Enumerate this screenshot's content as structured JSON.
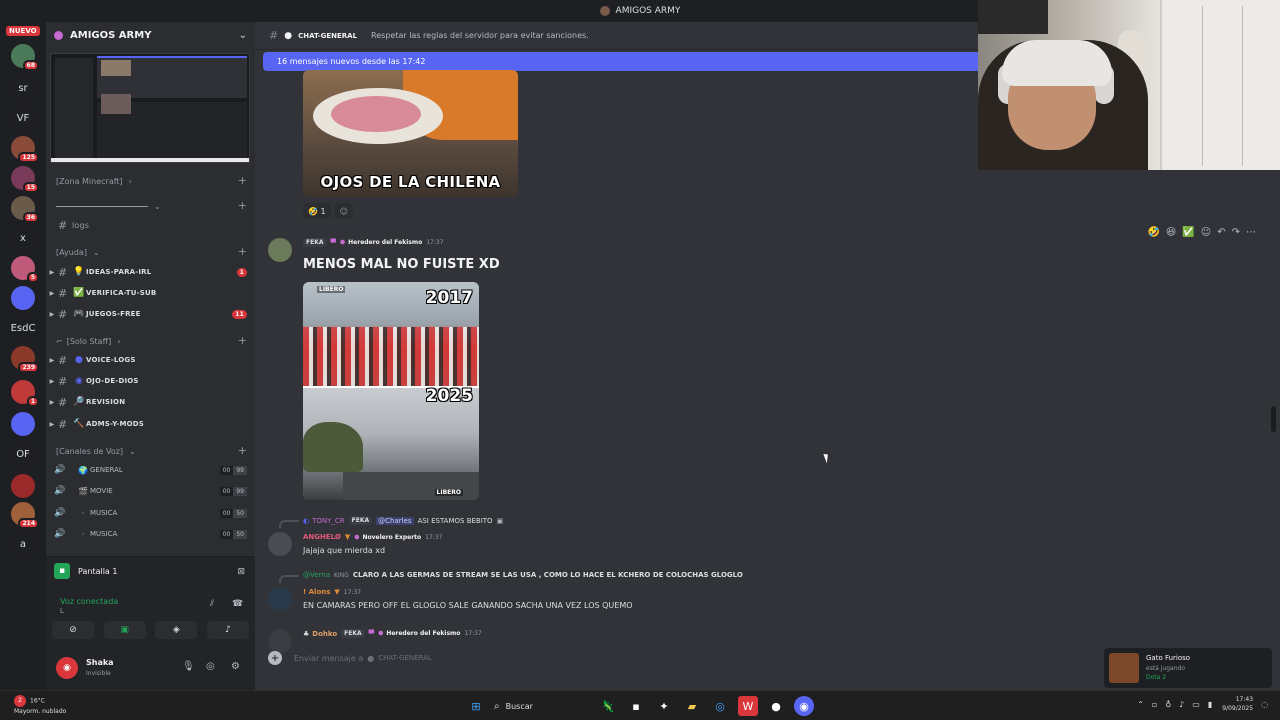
{
  "window": {
    "title": "AMIGOS ARMY"
  },
  "rail": {
    "new_label": "NUEVO",
    "servers": [
      {
        "label": "",
        "count": "68",
        "color": "#4a7a5a"
      },
      {
        "label": "sr",
        "count": "",
        "color": "#1e1f22"
      },
      {
        "label": "VF",
        "count": "",
        "color": "#1e1f22"
      },
      {
        "label": "",
        "count": "125",
        "color": "#8a4a3a"
      },
      {
        "label": "",
        "count": "15",
        "color": "#7a3a5a"
      },
      {
        "label": "",
        "count": "36",
        "color": "#6a5a4a"
      },
      {
        "label": "x",
        "count": "",
        "color": "#1e1f22"
      },
      {
        "label": "",
        "count": "5",
        "color": "#c05a7a"
      },
      {
        "label": "",
        "count": "",
        "color": "#5865f2"
      },
      {
        "label": "EsdC",
        "count": "",
        "color": "#1e1f22"
      },
      {
        "label": "",
        "count": "239",
        "color": "#8a3a2a"
      },
      {
        "label": "",
        "count": "1",
        "color": "#c03a3a"
      },
      {
        "label": "",
        "count": "",
        "color": "#5865f2"
      },
      {
        "label": "OF",
        "count": "",
        "color": "#1e1f22"
      },
      {
        "label": "",
        "count": "",
        "color": "#9a2a2a"
      },
      {
        "label": "",
        "count": "214",
        "color": "#a0603a"
      },
      {
        "label": "a",
        "count": "",
        "color": "#1e1f22"
      }
    ]
  },
  "sidebar": {
    "server_name": "AMIGOS ARMY",
    "cats": {
      "minecraft": "[Zona Minecraft]",
      "ayuda": "[Ayuda]",
      "staff": "[Solo Staff]",
      "voz": "[Canales de Voz]"
    },
    "logs": "logs",
    "channels": {
      "ideas": "IDEAS-PARA-IRL",
      "ideas_badge": "1",
      "verifica": "VERIFICA-TU-SUB",
      "juegos": "JUEGOS-FREE",
      "juegos_badge": "11",
      "voicelogs": "VOICE-LOGS",
      "ojo": "OJO-DE-DIOS",
      "revision": "REVISION",
      "adms": "ADMS-Y-MODS"
    },
    "voice": [
      {
        "name": "GENERAL",
        "a": "00",
        "b": "99"
      },
      {
        "name": "MOVIE",
        "a": "00",
        "b": "99"
      },
      {
        "name": "MUSICA",
        "a": "00",
        "b": "50"
      },
      {
        "name": "MUSICA",
        "a": "00",
        "b": "50"
      }
    ],
    "voice_panel": {
      "screen": "Pantalla 1",
      "status": "Voz conectada",
      "sub": "L"
    },
    "user": {
      "name": "Shaka",
      "status": "Invisible"
    }
  },
  "chat": {
    "channel": "CHAT-GENERAL",
    "topic": "Respetar las reglas del servidor para evitar sanciones.",
    "new_bar": "16 mensajes nuevos desde las 17:42",
    "image1_caption": "OJOS DE LA CHILENA",
    "reaction_count": "1",
    "msg_feka": {
      "user": "FEKA",
      "role": "Heredero del Fekismo",
      "time": "17:37",
      "text": "MENOS MAL NO FUISTE XD",
      "year_top": "2017",
      "year_bottom": "2025",
      "logo": "LIBERO"
    },
    "msg_anghelo": {
      "reply_user": "TONY_CR",
      "reply_tag": "FEKA",
      "reply_mention": "@Charles",
      "reply_text": "ASI ESTAMOS BEBITO",
      "user": "ANGHELØ",
      "role": "Novelero Experto",
      "time": "17:37",
      "text": "Jajaja que mierda xd"
    },
    "msg_alons": {
      "reply_user": "@Verna",
      "reply_tag": "KING",
      "reply_text": "CLARO A LAS GERMAS DE STREAM SE LAS USA , COMO LO HACE EL KCHERO DE COLOCHAS GLOGLO",
      "user": "! Alons",
      "time": "17:37",
      "text": "EN CAMARAS PERO OFF EL GLOGLO SALE GANANDO SACHA UNA VEZ LOS QUEMO"
    },
    "msg_dohko": {
      "user": "Dohko",
      "tag": "FEKA",
      "role": "Heredero del Fekismo",
      "time": "17:37"
    },
    "composer_placeholder": "Enviar mensaje a",
    "composer_channel": "CHAT-GENERAL"
  },
  "activity": {
    "name": "Gato Furioso",
    "status": "está jugando",
    "game": "Dota 2"
  },
  "taskbar": {
    "temp": "16°C",
    "weather": "Mayorm. nublado",
    "weather_badge": "2",
    "search": "Buscar",
    "time": "17:43",
    "date": "9/09/2025"
  },
  "colors": {
    "accent": "#5865f2",
    "online": "#23a559",
    "alert": "#da373c"
  }
}
